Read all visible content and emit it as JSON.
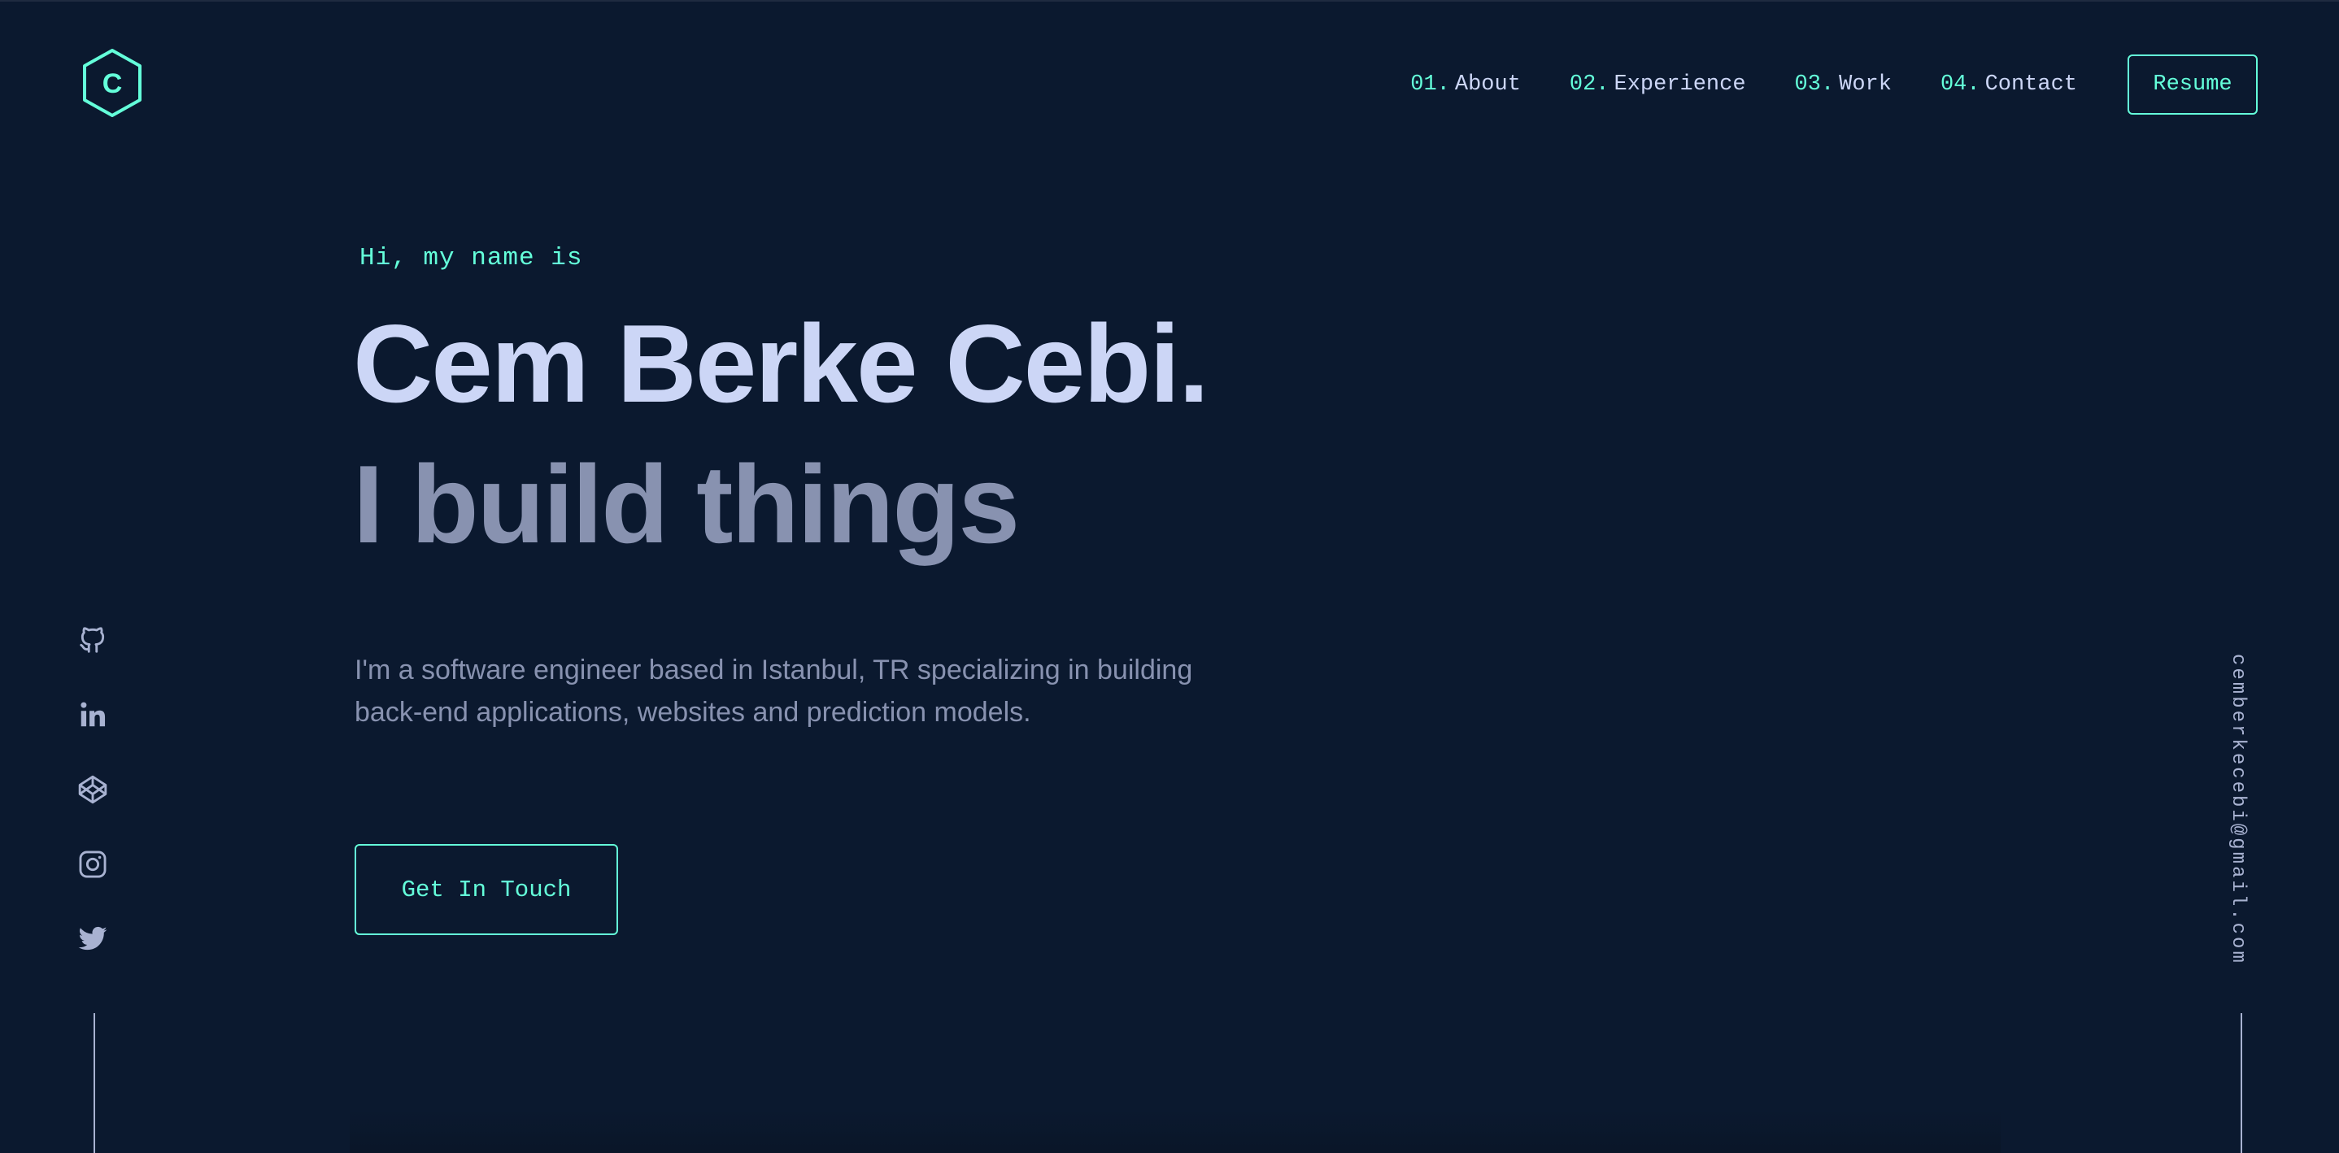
{
  "logo": {
    "letter": "C",
    "icon": "hexagon-logo-icon"
  },
  "nav": {
    "items": [
      {
        "num": "01.",
        "label": "About"
      },
      {
        "num": "02.",
        "label": "Experience"
      },
      {
        "num": "03.",
        "label": "Work"
      },
      {
        "num": "04.",
        "label": "Contact"
      }
    ],
    "resume_label": "Resume"
  },
  "hero": {
    "intro": "Hi, my name is",
    "name": "Cem Berke Cebi.",
    "tagline": "I build things",
    "description": "I'm a software engineer based in Istanbul, TR specializing in building back-end applications, websites and prediction models.",
    "cta_label": "Get In Touch"
  },
  "social": {
    "icons": [
      "github-icon",
      "linkedin-icon",
      "codepen-icon",
      "instagram-icon",
      "twitter-icon"
    ]
  },
  "email": "cemberkecebi@gmail.com",
  "colors": {
    "background": "#0b192f",
    "accent": "#64ffda",
    "heading": "#ccd6f6",
    "muted": "#8892b0",
    "light": "#a8b2d1"
  }
}
